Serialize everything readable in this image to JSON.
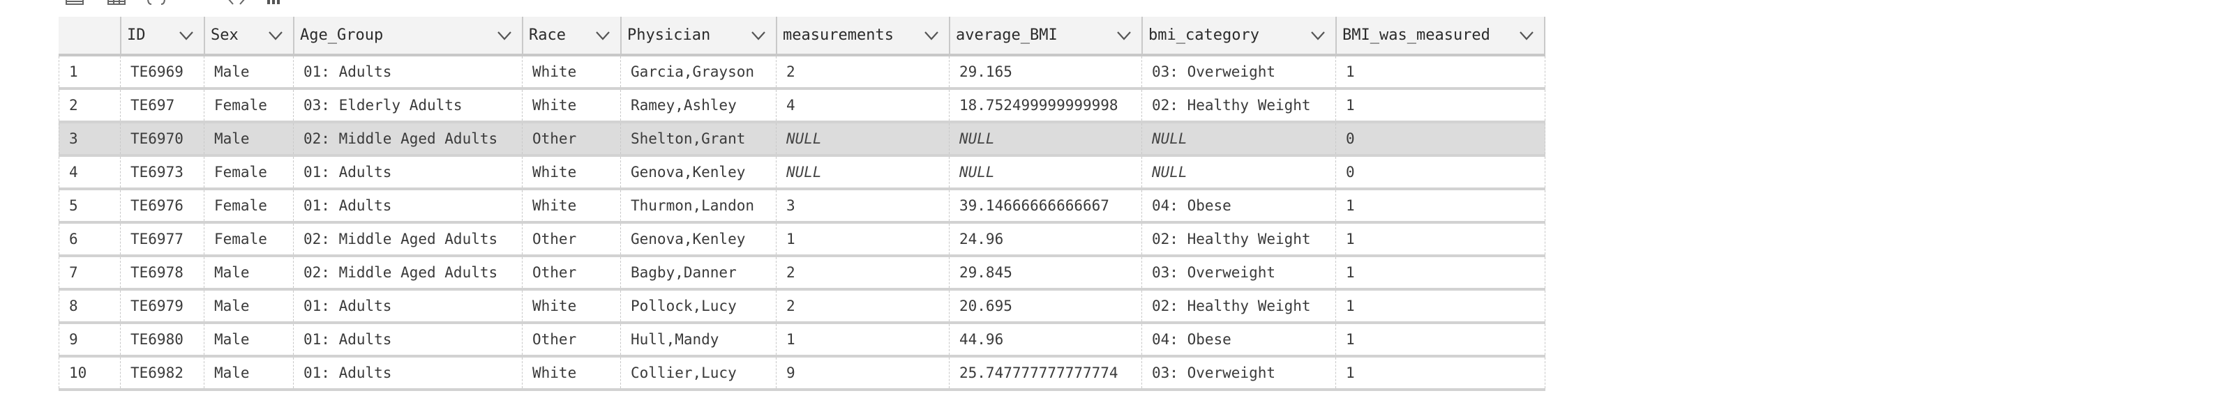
{
  "toolbar": {
    "icons": [
      {
        "name": "table-view-icon"
      },
      {
        "name": "grid-view-icon"
      },
      {
        "name": "json-braces-icon"
      },
      {
        "name": "text-view-icon"
      },
      {
        "name": "code-view-icon"
      },
      {
        "name": "chart-view-icon"
      }
    ]
  },
  "table": {
    "columns": [
      {
        "key": "rownum",
        "label": ""
      },
      {
        "key": "ID",
        "label": "ID",
        "icon": "chevron-down-icon"
      },
      {
        "key": "Sex",
        "label": "Sex",
        "icon": "chevron-down-icon"
      },
      {
        "key": "Age_Group",
        "label": "Age_Group",
        "icon": "chevron-down-icon"
      },
      {
        "key": "Race",
        "label": "Race",
        "icon": "chevron-down-icon"
      },
      {
        "key": "Physician",
        "label": "Physician",
        "icon": "chevron-down-icon"
      },
      {
        "key": "measurements",
        "label": "measurements",
        "icon": "chevron-down-icon"
      },
      {
        "key": "average_BMI",
        "label": "average_BMI",
        "icon": "chevron-down-icon"
      },
      {
        "key": "bmi_category",
        "label": "bmi_category",
        "icon": "chevron-down-icon"
      },
      {
        "key": "BMI_was_measured",
        "label": "BMI_was_measured",
        "icon": "chevron-down-icon"
      }
    ],
    "selected_row_index": 2,
    "null_label": "NULL",
    "rows": [
      [
        "1",
        "TE6969",
        "Male",
        "01: Adults",
        "White",
        "Garcia,Grayson",
        "2",
        "29.165",
        "03: Overweight",
        "1"
      ],
      [
        "2",
        "TE697",
        "Female",
        "03: Elderly Adults",
        "White",
        "Ramey,Ashley",
        "4",
        "18.752499999999998",
        "02: Healthy Weight",
        "1"
      ],
      [
        "3",
        "TE6970",
        "Male",
        "02: Middle Aged Adults",
        "Other",
        "Shelton,Grant",
        "NULL",
        "NULL",
        "NULL",
        "0"
      ],
      [
        "4",
        "TE6973",
        "Female",
        "01: Adults",
        "White",
        "Genova,Kenley",
        "NULL",
        "NULL",
        "NULL",
        "0"
      ],
      [
        "5",
        "TE6976",
        "Female",
        "01: Adults",
        "White",
        "Thurmon,Landon",
        "3",
        "39.14666666666667",
        "04: Obese",
        "1"
      ],
      [
        "6",
        "TE6977",
        "Female",
        "02: Middle Aged Adults",
        "Other",
        "Genova,Kenley",
        "1",
        "24.96",
        "02: Healthy Weight",
        "1"
      ],
      [
        "7",
        "TE6978",
        "Male",
        "02: Middle Aged Adults",
        "Other",
        "Bagby,Danner",
        "2",
        "29.845",
        "03: Overweight",
        "1"
      ],
      [
        "8",
        "TE6979",
        "Male",
        "01: Adults",
        "White",
        "Pollock,Lucy",
        "2",
        "20.695",
        "02: Healthy Weight",
        "1"
      ],
      [
        "9",
        "TE6980",
        "Male",
        "01: Adults",
        "Other",
        "Hull,Mandy",
        "1",
        "44.96",
        "04: Obese",
        "1"
      ],
      [
        "10",
        "TE6982",
        "Male",
        "01: Adults",
        "White",
        "Collier,Lucy",
        "9",
        "25.747777777777774",
        "03: Overweight",
        "1"
      ]
    ]
  }
}
